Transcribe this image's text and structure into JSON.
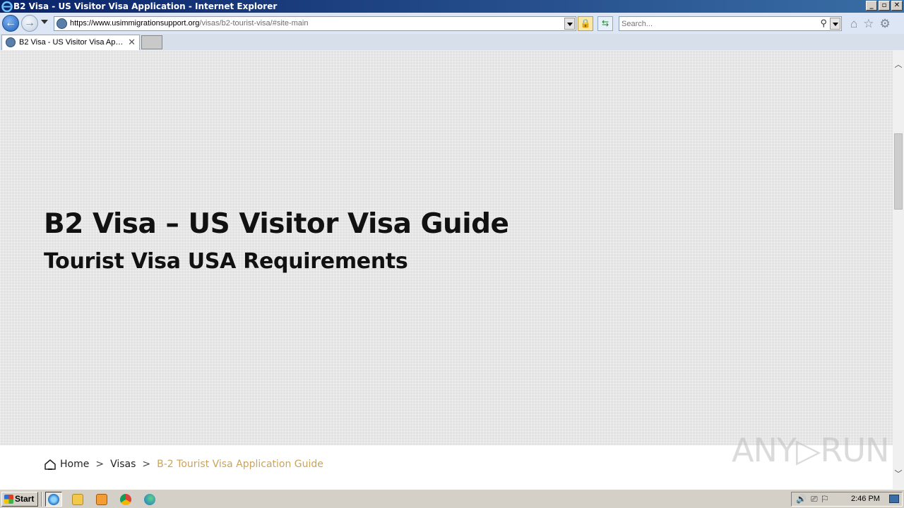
{
  "window": {
    "title": "B2 Visa - US Visitor Visa Application - Internet Explorer",
    "buttons": {
      "minimize": "_",
      "maximize": "▫",
      "close": "✕"
    }
  },
  "navbar": {
    "back_glyph": "←",
    "forward_glyph": "→",
    "url_prefix": "https://www.",
    "url_domain": "usimmigrationsupport.org",
    "url_path": "/visas/b2-tourist-visa/#site-main",
    "lock_glyph": "🔒",
    "refresh_glyph": "⇆",
    "search_placeholder": "Search...",
    "search_glyph": "⚲",
    "home_glyph": "⌂",
    "favorites_glyph": "☆",
    "tools_glyph": "⚙"
  },
  "tabs": [
    {
      "label": "B2 Visa - US Visitor Visa Appli...",
      "close_glyph": "✕"
    }
  ],
  "page": {
    "hero_title": "B2 Visa – US Visitor Visa Guide",
    "hero_subtitle": "Tourist Visa USA Requirements",
    "breadcrumb": {
      "home": "Home",
      "separator": ">",
      "level1": "Visas",
      "current": "B-2 Tourist Visa Application Guide"
    },
    "watermark": "ANY▷RUN"
  },
  "scrollbar": {
    "up": "︿",
    "down": "﹀"
  },
  "taskbar": {
    "start_label": "Start",
    "tray_icons": "🔊⎚⚐",
    "clock": "2:46 PM"
  },
  "colors": {
    "breadcrumb_current": "#c9a45a",
    "hero_background": "#e2e2e2",
    "title_bar": "#0a246a"
  }
}
